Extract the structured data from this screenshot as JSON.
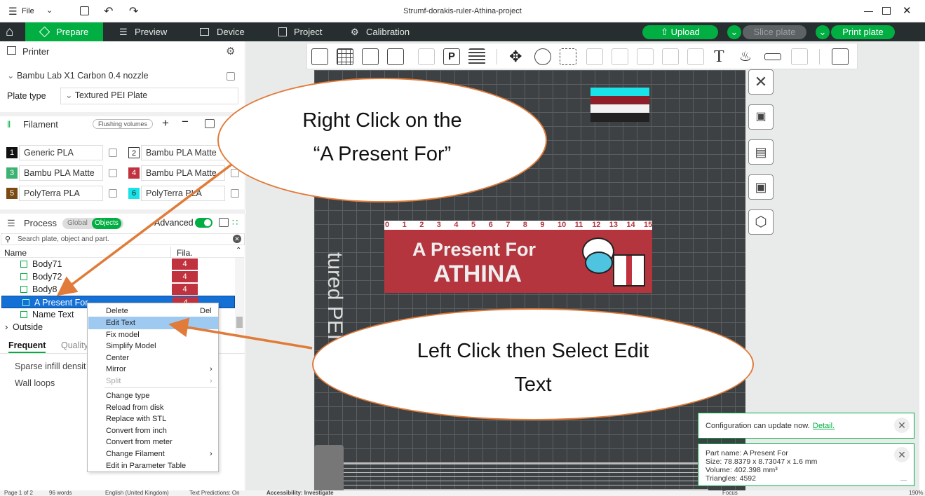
{
  "window": {
    "title": "Strumf-dorakis-ruler-Athina-project",
    "menu_label": "File"
  },
  "tabs": [
    {
      "label": "Prepare",
      "active": true
    },
    {
      "label": "Preview"
    },
    {
      "label": "Device"
    },
    {
      "label": "Project"
    },
    {
      "label": "Calibration"
    }
  ],
  "actions": {
    "upload": "Upload",
    "slice": "Slice plate",
    "print": "Print plate"
  },
  "printer": {
    "section_label": "Printer",
    "name": "Bambu Lab X1 Carbon 0.4 nozzle",
    "plate_type_label": "Plate type",
    "plate_type": "Textured PEI Plate"
  },
  "filament": {
    "section_label": "Filament",
    "flushing_label": "Flushing volumes",
    "slots": [
      {
        "num": "1",
        "name": "Generic PLA",
        "color": "#111111"
      },
      {
        "num": "2",
        "name": "Bambu PLA Matte",
        "color": "#ffffff"
      },
      {
        "num": "3",
        "name": "Bambu PLA Matte",
        "color": "#3cb371"
      },
      {
        "num": "4",
        "name": "Bambu PLA Matte",
        "color": "#c0323e"
      },
      {
        "num": "5",
        "name": "PolyTerra PLA",
        "color": "#7a4a12"
      },
      {
        "num": "6",
        "name": "PolyTerra PLA",
        "color": "#19e3e8"
      }
    ]
  },
  "process": {
    "section_label": "Process",
    "global_label": "Global",
    "objects_label": "Objects",
    "advanced_label": "Advanced",
    "search_placeholder": "Search plate, object and part.",
    "col_name": "Name",
    "col_fila": "Fila."
  },
  "tree": [
    {
      "label": "Body71",
      "fila": "4"
    },
    {
      "label": "Body72",
      "fila": "4"
    },
    {
      "label": "Body8",
      "fila": "4"
    },
    {
      "label": "A Present For",
      "fila": "4",
      "selected": true
    },
    {
      "label": "Name Text",
      "fila": ""
    },
    {
      "label": "Outside",
      "fila": ""
    }
  ],
  "settings_tabs": {
    "frequent": "Frequent",
    "quality": "Quality"
  },
  "settings_rows": [
    "Sparse infill densit",
    "Wall loops"
  ],
  "context_menu": [
    {
      "label": "Delete",
      "shortcut": "Del"
    },
    {
      "label": "Edit Text",
      "highlighted": true
    },
    {
      "label": "Fix model"
    },
    {
      "label": "Simplify Model"
    },
    {
      "label": "Center"
    },
    {
      "label": "Mirror",
      "submenu": true
    },
    {
      "label": "Split",
      "submenu": true,
      "disabled": true
    },
    {
      "label": "Change type"
    },
    {
      "label": "Reload from disk"
    },
    {
      "label": "Replace with STL"
    },
    {
      "label": "Convert from inch"
    },
    {
      "label": "Convert from meter"
    },
    {
      "label": "Change Filament",
      "submenu": true
    },
    {
      "label": "Edit in Parameter Table"
    }
  ],
  "plate": {
    "label_vertical": "tured PEI Pla",
    "ruler_numbers": [
      "0",
      "1",
      "2",
      "3",
      "4",
      "5",
      "6",
      "7",
      "8",
      "9",
      "10",
      "11",
      "12",
      "13",
      "14",
      "15"
    ],
    "text_line1": "A Present For",
    "text_line2": "ATHINA"
  },
  "callouts": {
    "right_click": [
      "Right Click on the",
      "“A Present For”"
    ],
    "left_click": [
      "Left Click then Select Edit",
      "Text"
    ]
  },
  "notifications": {
    "config_text": "Configuration can update now.",
    "config_link": "Detail.",
    "part_name": "Part name: A Present For",
    "size": "Size: 78.8379 x 8.73047 x 1.6 mm",
    "volume": "Volume: 402.398 mm³",
    "triangles": "Triangles: 4592"
  },
  "statusbar": {
    "page": "Page 1 of 2",
    "words": "96 words",
    "language": "English (United Kingdom)",
    "predictions": "Text Predictions: On",
    "accessibility": "Accessibility: Investigate",
    "focus": "Focus",
    "zoom": "190%"
  },
  "colors": {
    "accent": "#00ae42",
    "callout_border": "#e07b39",
    "tab_bar": "#262e30",
    "text_plate": "#b5353f"
  }
}
